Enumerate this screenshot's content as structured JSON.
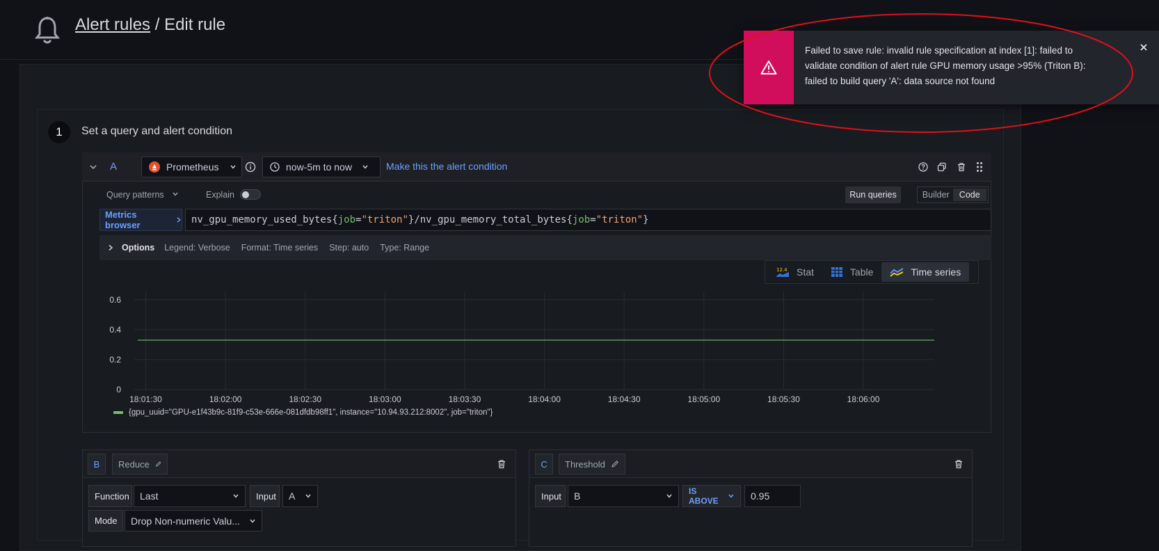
{
  "header": {
    "breadcrumb_link": "Alert rules",
    "breadcrumb_sep": "/",
    "breadcrumb_current": "Edit rule"
  },
  "step": {
    "number": "1",
    "title": "Set a query and alert condition"
  },
  "queryA": {
    "letter": "A",
    "datasource": "Prometheus",
    "time_range": "now-5m to now",
    "condition_link": "Make this the alert condition",
    "query_patterns": "Query patterns",
    "explain": "Explain",
    "run_queries": "Run queries",
    "builder": "Builder",
    "code": "Code",
    "metrics_browser": "Metrics browser",
    "expression_parts": [
      {
        "text": "nv_gpu_memory_used_bytes{",
        "color": "#ccccdc"
      },
      {
        "text": "job",
        "color": "#73bf69"
      },
      {
        "text": "=",
        "color": "#ccccdc"
      },
      {
        "text": "\"triton\"",
        "color": "#f2a46a"
      },
      {
        "text": "}/nv_gpu_memory_total_bytes{",
        "color": "#ccccdc"
      },
      {
        "text": "job",
        "color": "#73bf69"
      },
      {
        "text": "=",
        "color": "#ccccdc"
      },
      {
        "text": "\"triton\"",
        "color": "#f2a46a"
      },
      {
        "text": "}",
        "color": "#ccccdc"
      }
    ],
    "options": {
      "label": "Options",
      "legend": "Legend: Verbose",
      "format": "Format: Time series",
      "step": "Step: auto",
      "type": "Type: Range"
    },
    "vis_options": [
      {
        "label": "Stat",
        "icon": "stat-icon",
        "active": false
      },
      {
        "label": "Table",
        "icon": "table-icon",
        "active": false
      },
      {
        "label": "Time series",
        "icon": "timeseries-icon",
        "active": true
      }
    ]
  },
  "chart_data": {
    "type": "line",
    "y_ticks": [
      "0",
      "0.2",
      "0.4",
      "0.6"
    ],
    "ylim": [
      0,
      0.65
    ],
    "x_ticks": [
      "18:01:30",
      "18:02:00",
      "18:02:30",
      "18:03:00",
      "18:03:30",
      "18:04:00",
      "18:04:30",
      "18:05:00",
      "18:05:30",
      "18:06:00"
    ],
    "xlim": [
      "18:01:27",
      "18:06:28"
    ],
    "grid": true,
    "series": [
      {
        "name": "{gpu_uuid=\"GPU-e1f43b9c-81f9-c53e-666e-081dfdb98ff1\", instance=\"10.94.93.212:8002\", job=\"triton\"}",
        "color": "#73bf69",
        "x": [
          "18:01:27",
          "18:06:28"
        ],
        "y": [
          0.33,
          0.33
        ]
      }
    ]
  },
  "exprB": {
    "letter": "B",
    "name": "Reduce",
    "function_label": "Function",
    "function_value": "Last",
    "input_label": "Input",
    "input_value": "A",
    "mode_label": "Mode",
    "mode_value": "Drop Non-numeric Valu..."
  },
  "exprC": {
    "letter": "C",
    "name": "Threshold",
    "input_label": "Input",
    "input_value": "B",
    "operator": "IS ABOVE",
    "threshold": "0.95"
  },
  "toast": {
    "line1": "Failed to save rule: invalid rule specification at index [1]: failed to",
    "line2": "validate condition of alert rule GPU memory usage >95% (Triton B):",
    "line3": "failed to build query 'A': data source not found",
    "color": "#d10e5c"
  }
}
